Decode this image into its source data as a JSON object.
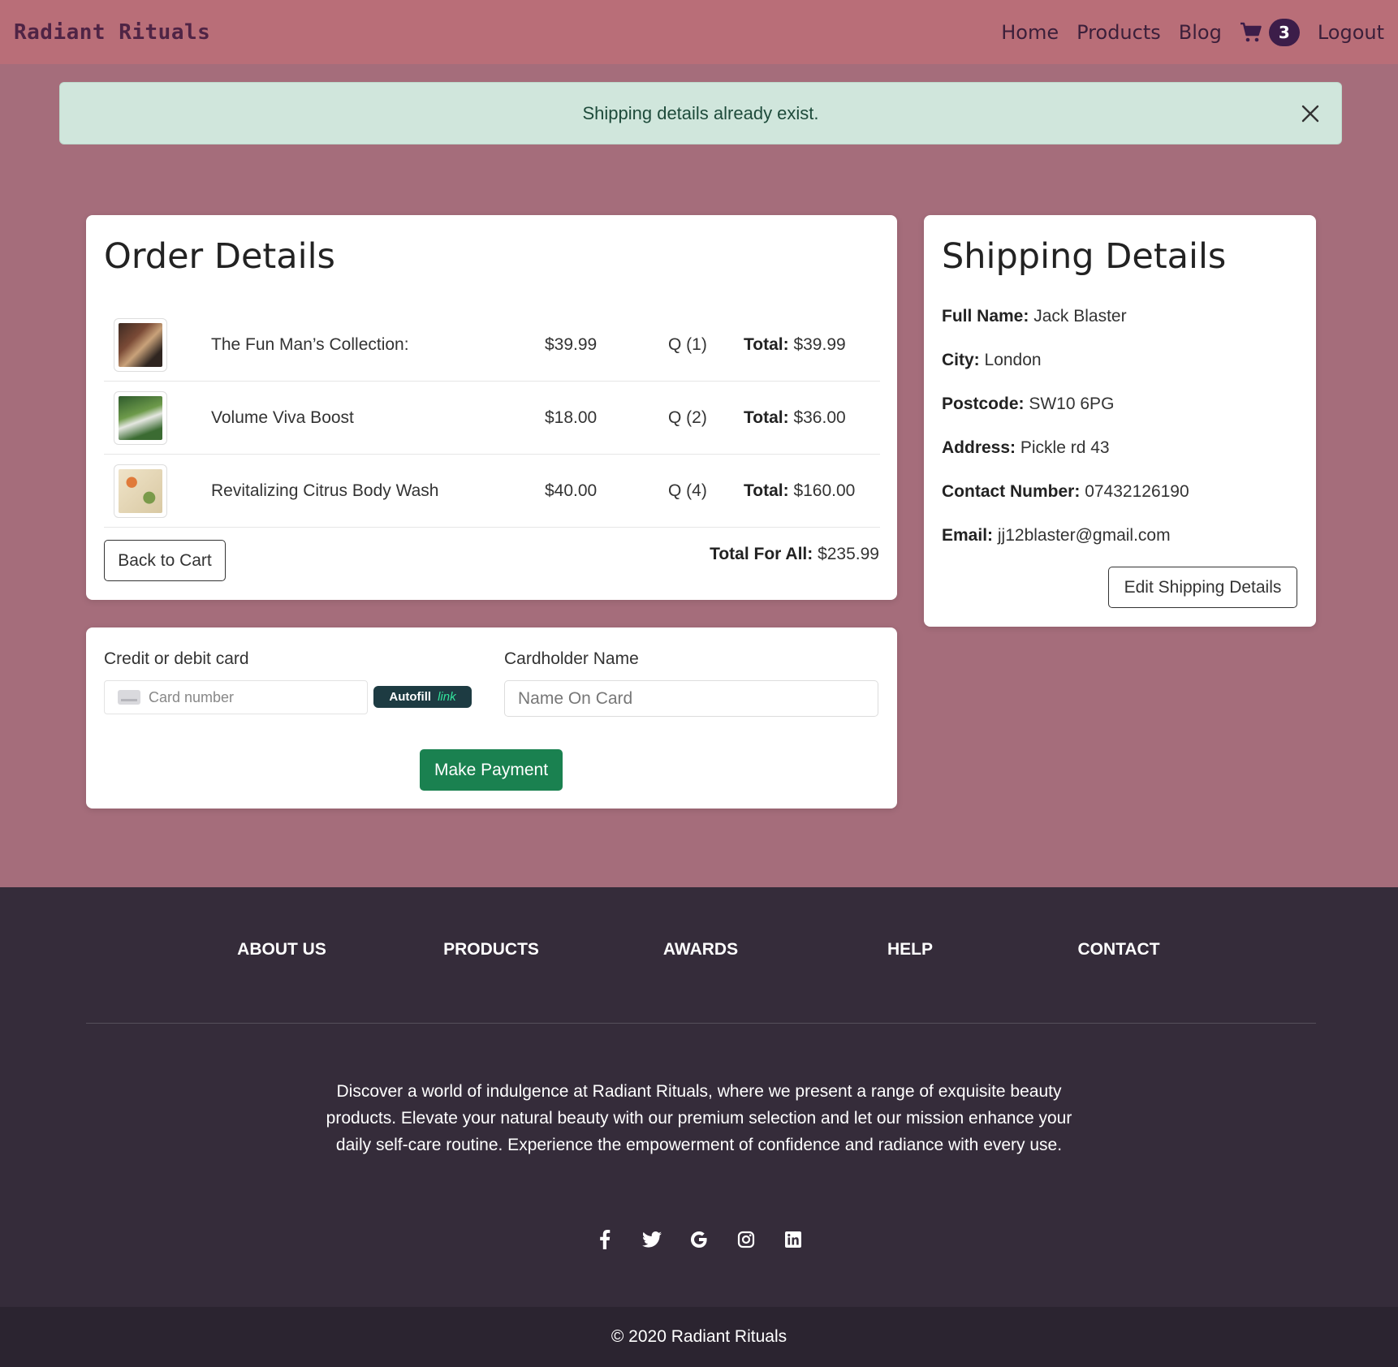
{
  "navbar": {
    "brand": "Radiant Rituals",
    "links": [
      "Home",
      "Products",
      "Blog"
    ],
    "cart_count": "3",
    "logout": "Logout"
  },
  "alert": {
    "message": "Shipping details already exist."
  },
  "order": {
    "title": "Order Details",
    "items": [
      {
        "name": "The Fun Man’s Collection:",
        "price": "$39.99",
        "qty": "Q (1)",
        "total_label": "Total:",
        "total": "$39.99"
      },
      {
        "name": "Volume Viva Boost",
        "price": "$18.00",
        "qty": "Q (2)",
        "total_label": "Total:",
        "total": "$36.00"
      },
      {
        "name": "Revitalizing Citrus Body Wash",
        "price": "$40.00",
        "qty": "Q (4)",
        "total_label": "Total:",
        "total": "$160.00"
      }
    ],
    "back_button": "Back to Cart",
    "grand_label": "Total For All:",
    "grand_total": "$235.99"
  },
  "shipping": {
    "title": "Shipping Details",
    "fields": [
      {
        "label": "Full Name:",
        "value": "Jack Blaster"
      },
      {
        "label": "City:",
        "value": "London"
      },
      {
        "label": "Postcode:",
        "value": "SW10 6PG"
      },
      {
        "label": "Address:",
        "value": "Pickle rd 43"
      },
      {
        "label": "Contact Number:",
        "value": "07432126190"
      },
      {
        "label": "Email:",
        "value": "jj12blaster@gmail.com"
      }
    ],
    "edit_button": "Edit Shipping Details"
  },
  "payment": {
    "card_label": "Credit or debit card",
    "card_placeholder": "Card number",
    "autofill_label": "Autofill",
    "autofill_link": "link",
    "name_label": "Cardholder Name",
    "name_placeholder": "Name On Card",
    "pay_button": "Make Payment"
  },
  "footer": {
    "links": [
      "ABOUT US",
      "PRODUCTS",
      "AWARDS",
      "HELP",
      "CONTACT"
    ],
    "text": "Discover a world of indulgence at Radiant Rituals, where we present a range of exquisite beauty products. Elevate your natural beauty with our premium selection and let our mission enhance your daily self-care routine. Experience the empowerment of confidence and radiance with every use.",
    "socials": [
      "facebook-icon",
      "twitter-icon",
      "google-icon",
      "instagram-icon",
      "linkedin-icon"
    ],
    "copyright": "© 2020 Radiant Rituals"
  },
  "colors": {
    "navbar": "#b96e78",
    "page": "#a56d7b",
    "alert": "#d0e6dc",
    "pay_button": "#1a8150",
    "footer": "#352c3a"
  }
}
